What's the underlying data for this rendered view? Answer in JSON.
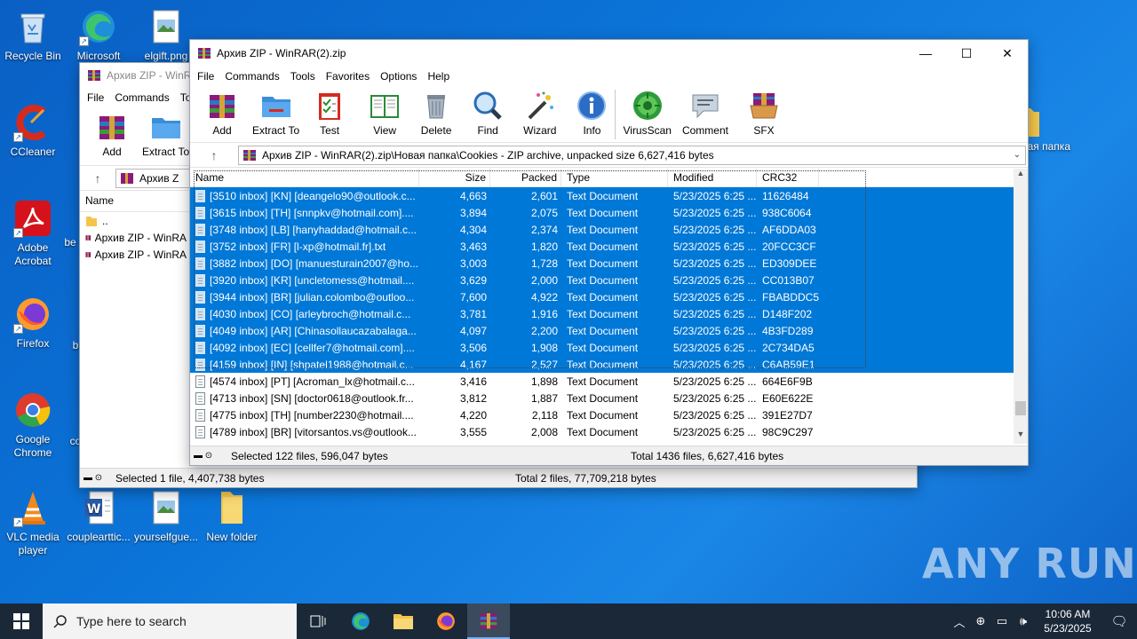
{
  "desktop": {
    "icons": [
      {
        "label": "Recycle Bin"
      },
      {
        "label": "Microsoft"
      },
      {
        "label": "elgift.png"
      },
      {
        "label": "CCleaner"
      },
      {
        "label": "Adobe Acrobat"
      },
      {
        "label": "be"
      },
      {
        "label": "Firefox"
      },
      {
        "label": "b"
      },
      {
        "label": "Google Chrome"
      },
      {
        "label": "co"
      },
      {
        "label": "VLC media player"
      },
      {
        "label": "couplearttic..."
      },
      {
        "label": "yourselfgue..."
      },
      {
        "label": "New folder"
      },
      {
        "label": "ная папка"
      }
    ]
  },
  "back_window": {
    "title": "Архив ZIP - WinR",
    "menu": [
      "File",
      "Commands",
      "To"
    ],
    "toolbar": [
      "Add",
      "Extract To"
    ],
    "path": "Архив Z",
    "header_name": "Name",
    "rows": [
      "..",
      "Архив ZIP - WinRA",
      "Архив ZIP - WinRA"
    ],
    "status_left": "Selected 1 file, 4,407,738 bytes",
    "status_right": "Total 2 files, 77,709,218 bytes"
  },
  "front_window": {
    "title": "Архив ZIP - WinRAR(2).zip",
    "menu": [
      "File",
      "Commands",
      "Tools",
      "Favorites",
      "Options",
      "Help"
    ],
    "toolbar": [
      {
        "label": "Add",
        "icon": "add-archive-icon"
      },
      {
        "label": "Extract To",
        "icon": "extract-folder-icon"
      },
      {
        "label": "Test",
        "icon": "test-clipboard-icon"
      },
      {
        "label": "View",
        "icon": "view-book-icon"
      },
      {
        "label": "Delete",
        "icon": "trash-icon"
      },
      {
        "label": "Find",
        "icon": "magnifier-icon"
      },
      {
        "label": "Wizard",
        "icon": "wand-icon"
      },
      {
        "label": "Info",
        "icon": "info-icon"
      },
      {
        "label": "VirusScan",
        "icon": "virus-scan-icon"
      },
      {
        "label": "Comment",
        "icon": "comment-icon"
      },
      {
        "label": "SFX",
        "icon": "sfx-box-icon"
      }
    ],
    "path": "Архив ZIP - WinRAR(2).zip\\Новая папка\\Cookies - ZIP archive, unpacked size 6,627,416 bytes",
    "columns": {
      "name": "Name",
      "size": "Size",
      "packed": "Packed",
      "type": "Type",
      "modified": "Modified",
      "crc": "CRC32"
    },
    "files": [
      {
        "name": "[3510 inbox] [KN] [deangelo90@outlook.c...",
        "size": "4,663",
        "packed": "2,601",
        "type": "Text Document",
        "modified": "5/23/2025 6:25 ...",
        "crc": "11626484",
        "selected": true
      },
      {
        "name": "[3615 inbox] [TH] [snnpkv@hotmail.com]....",
        "size": "3,894",
        "packed": "2,075",
        "type": "Text Document",
        "modified": "5/23/2025 6:25 ...",
        "crc": "938C6064",
        "selected": true
      },
      {
        "name": "[3748 inbox] [LB] [hanyhaddad@hotmail.c...",
        "size": "4,304",
        "packed": "2,374",
        "type": "Text Document",
        "modified": "5/23/2025 6:25 ...",
        "crc": "AF6DDA03",
        "selected": true
      },
      {
        "name": "[3752 inbox] [FR] [l-xp@hotmail.fr].txt",
        "size": "3,463",
        "packed": "1,820",
        "type": "Text Document",
        "modified": "5/23/2025 6:25 ...",
        "crc": "20FCC3CF",
        "selected": true
      },
      {
        "name": "[3882 inbox] [DO] [manuesturain2007@ho...",
        "size": "3,003",
        "packed": "1,728",
        "type": "Text Document",
        "modified": "5/23/2025 6:25 ...",
        "crc": "ED309DEE",
        "selected": true
      },
      {
        "name": "[3920 inbox] [KR] [uncletomess@hotmail....",
        "size": "3,629",
        "packed": "2,000",
        "type": "Text Document",
        "modified": "5/23/2025 6:25 ...",
        "crc": "CC013B07",
        "selected": true
      },
      {
        "name": "[3944 inbox] [BR] [julian.colombo@outloo...",
        "size": "7,600",
        "packed": "4,922",
        "type": "Text Document",
        "modified": "5/23/2025 6:25 ...",
        "crc": "FBABDDC5",
        "selected": true
      },
      {
        "name": "[4030 inbox] [CO] [arleybroch@hotmail.c...",
        "size": "3,781",
        "packed": "1,916",
        "type": "Text Document",
        "modified": "5/23/2025 6:25 ...",
        "crc": "D148F202",
        "selected": true
      },
      {
        "name": "[4049 inbox] [AR] [Chinasollaucazabalaga...",
        "size": "4,097",
        "packed": "2,200",
        "type": "Text Document",
        "modified": "5/23/2025 6:25 ...",
        "crc": "4B3FD289",
        "selected": true
      },
      {
        "name": "[4092 inbox] [EC] [cellfer7@hotmail.com]....",
        "size": "3,506",
        "packed": "1,908",
        "type": "Text Document",
        "modified": "5/23/2025 6:25 ...",
        "crc": "2C734DA5",
        "selected": true
      },
      {
        "name": "[4159 inbox] [IN] [shpatel1988@hotmail.c...",
        "size": "4,167",
        "packed": "2,527",
        "type": "Text Document",
        "modified": "5/23/2025 6:25 ...",
        "crc": "C6AB59E1",
        "selected": true
      },
      {
        "name": "[4574 inbox] [PT] [Acroman_lx@hotmail.c...",
        "size": "3,416",
        "packed": "1,898",
        "type": "Text Document",
        "modified": "5/23/2025 6:25 ...",
        "crc": "664E6F9B",
        "selected": false
      },
      {
        "name": "[4713 inbox] [SN] [doctor0618@outlook.fr...",
        "size": "3,812",
        "packed": "1,887",
        "type": "Text Document",
        "modified": "5/23/2025 6:25 ...",
        "crc": "E60E622E",
        "selected": false
      },
      {
        "name": "[4775 inbox] [TH] [number2230@hotmail....",
        "size": "4,220",
        "packed": "2,118",
        "type": "Text Document",
        "modified": "5/23/2025 6:25 ...",
        "crc": "391E27D7",
        "selected": false
      },
      {
        "name": "[4789 inbox] [BR] [vitorsantos.vs@outlook...",
        "size": "3,555",
        "packed": "2,008",
        "type": "Text Document",
        "modified": "5/23/2025 6:25 ...",
        "crc": "98C9C297",
        "selected": false
      }
    ],
    "status_left": "Selected 122 files, 596,047 bytes",
    "status_right": "Total 1436 files, 6,627,416 bytes"
  },
  "taskbar": {
    "search_placeholder": "Type here to search",
    "time": "10:06 AM",
    "date": "5/23/2025"
  },
  "watermark": "ANY RUN"
}
